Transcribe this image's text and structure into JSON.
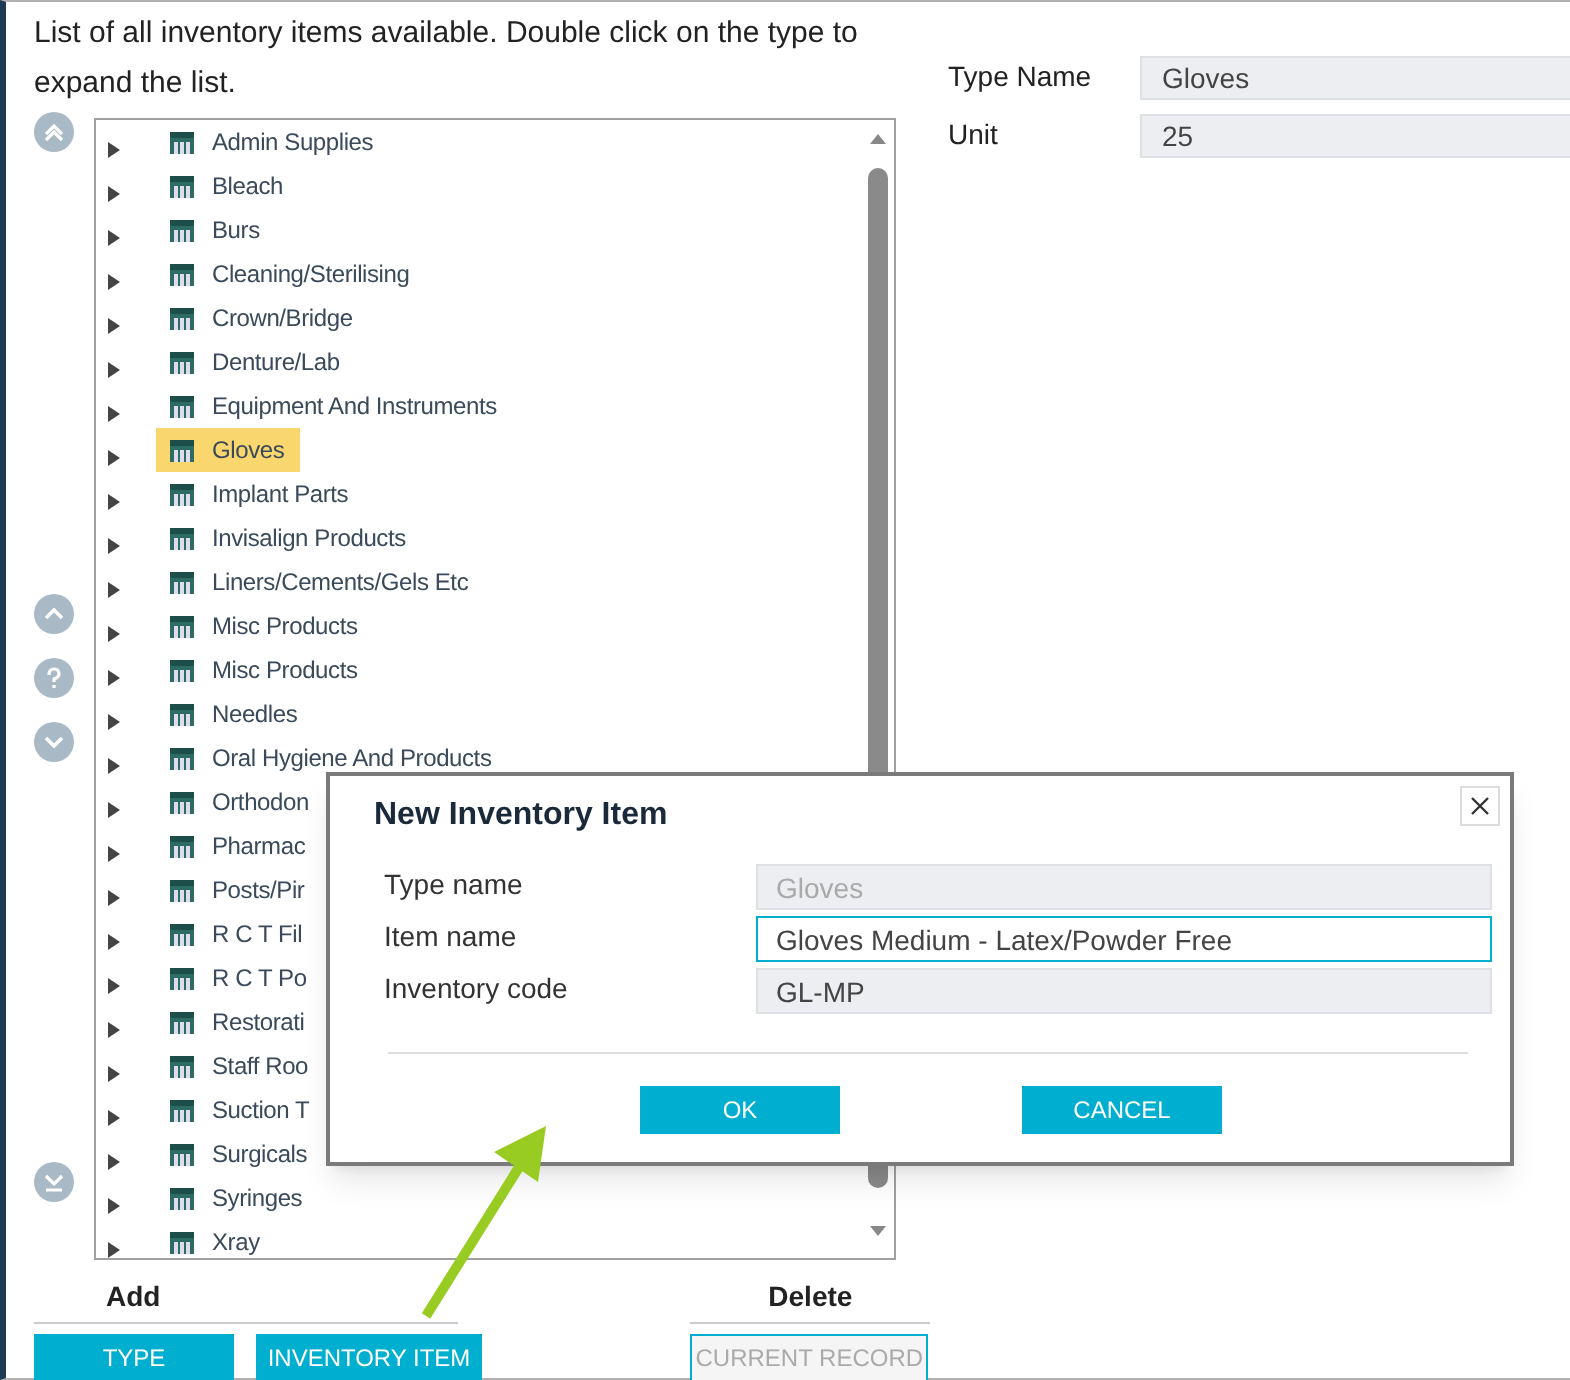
{
  "intro": "List of all inventory items available. Double click on the type to expand the list.",
  "tree": {
    "items": [
      {
        "label": "Admin Supplies",
        "selected": false,
        "expanded": false
      },
      {
        "label": "Bleach",
        "selected": false,
        "expanded": false
      },
      {
        "label": "Burs",
        "selected": false,
        "expanded": false
      },
      {
        "label": "Cleaning/Sterilising",
        "selected": false,
        "expanded": false
      },
      {
        "label": "Crown/Bridge",
        "selected": false,
        "expanded": false
      },
      {
        "label": "Denture/Lab",
        "selected": false,
        "expanded": false
      },
      {
        "label": "Equipment And Instruments",
        "selected": false,
        "expanded": false
      },
      {
        "label": "Gloves",
        "selected": true,
        "expanded": false
      },
      {
        "label": "Implant Parts",
        "selected": false,
        "expanded": false
      },
      {
        "label": "Invisalign Products",
        "selected": false,
        "expanded": false
      },
      {
        "label": "Liners/Cements/Gels Etc",
        "selected": false,
        "expanded": false
      },
      {
        "label": "Misc Products",
        "selected": false,
        "expanded": false
      },
      {
        "label": "Misc Products",
        "selected": false,
        "expanded": false
      },
      {
        "label": "Needles",
        "selected": false,
        "expanded": false
      },
      {
        "label": "Oral Hygiene And Products",
        "selected": false,
        "expanded": false
      },
      {
        "label": "Orthodon",
        "selected": false,
        "expanded": false
      },
      {
        "label": "Pharmac",
        "selected": false,
        "expanded": false
      },
      {
        "label": "Posts/Pir",
        "selected": false,
        "expanded": false
      },
      {
        "label": "R C T Fil",
        "selected": false,
        "expanded": false
      },
      {
        "label": "R C T Po",
        "selected": false,
        "expanded": false
      },
      {
        "label": "Restorati",
        "selected": false,
        "expanded": false
      },
      {
        "label": "Staff Roo",
        "selected": false,
        "expanded": false
      },
      {
        "label": "Suction T",
        "selected": false,
        "expanded": false
      },
      {
        "label": "Surgicals",
        "selected": false,
        "expanded": false
      },
      {
        "label": "Syringes",
        "selected": false,
        "expanded": false
      },
      {
        "label": "Xray",
        "selected": false,
        "expanded": false
      }
    ]
  },
  "details": {
    "fields": [
      {
        "label": "Type Name",
        "value": "Gloves"
      },
      {
        "label": "Unit",
        "value": "25"
      }
    ]
  },
  "actions": [
    {
      "heading": "Add",
      "buttons": [
        {
          "label": "TYPE",
          "disabled": false
        },
        {
          "label": "INVENTORY ITEM",
          "disabled": false
        }
      ]
    },
    {
      "heading": "Delete",
      "buttons": [
        {
          "label": "CURRENT RECORD",
          "disabled": true
        }
      ]
    }
  ],
  "dialog": {
    "title": "New Inventory Item",
    "fields": [
      {
        "label": "Type name",
        "value": "Gloves",
        "disabled": true,
        "focused": false
      },
      {
        "label": "Item name",
        "value": "Gloves Medium - Latex/Powder Free",
        "disabled": false,
        "focused": true
      },
      {
        "label": "Inventory code",
        "value": "GL-MP",
        "disabled": false,
        "focused": false
      }
    ],
    "buttons": [
      "OK",
      "CANCEL"
    ]
  }
}
